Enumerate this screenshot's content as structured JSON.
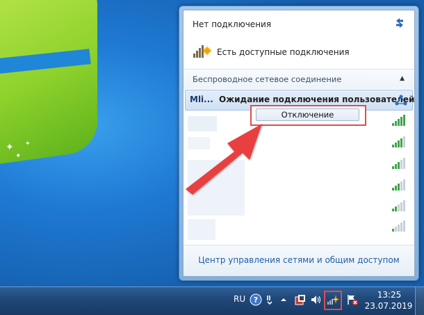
{
  "flyout": {
    "status_title": "Нет подключения",
    "available_text": "Есть доступные подключения",
    "section_title": "Беспроводное сетевое соединение",
    "selected_network_name": "Mli...",
    "selected_network_status": "Ожидание подключения пользователей",
    "network_center_link": "Центр управления сетями и общим доступом",
    "icons": {
      "refresh": "refresh-icon",
      "collapse": "chevron-up-icon",
      "available": "signal-bars-star-icon",
      "signal": "wifi-signal-icon"
    }
  },
  "context_menu": {
    "item_label": "Отключение"
  },
  "taskbar": {
    "language": "RU",
    "time": "13:25",
    "date": "23.07.2019",
    "icons": [
      "help-icon",
      "flag-icon",
      "chevron-up-icon",
      "security-icon",
      "volume-icon",
      "network-icon",
      "action-center-icon"
    ]
  },
  "colors": {
    "highlight": "#e14b4b",
    "link": "#1f5ea8",
    "taskbar": "#20487a"
  }
}
